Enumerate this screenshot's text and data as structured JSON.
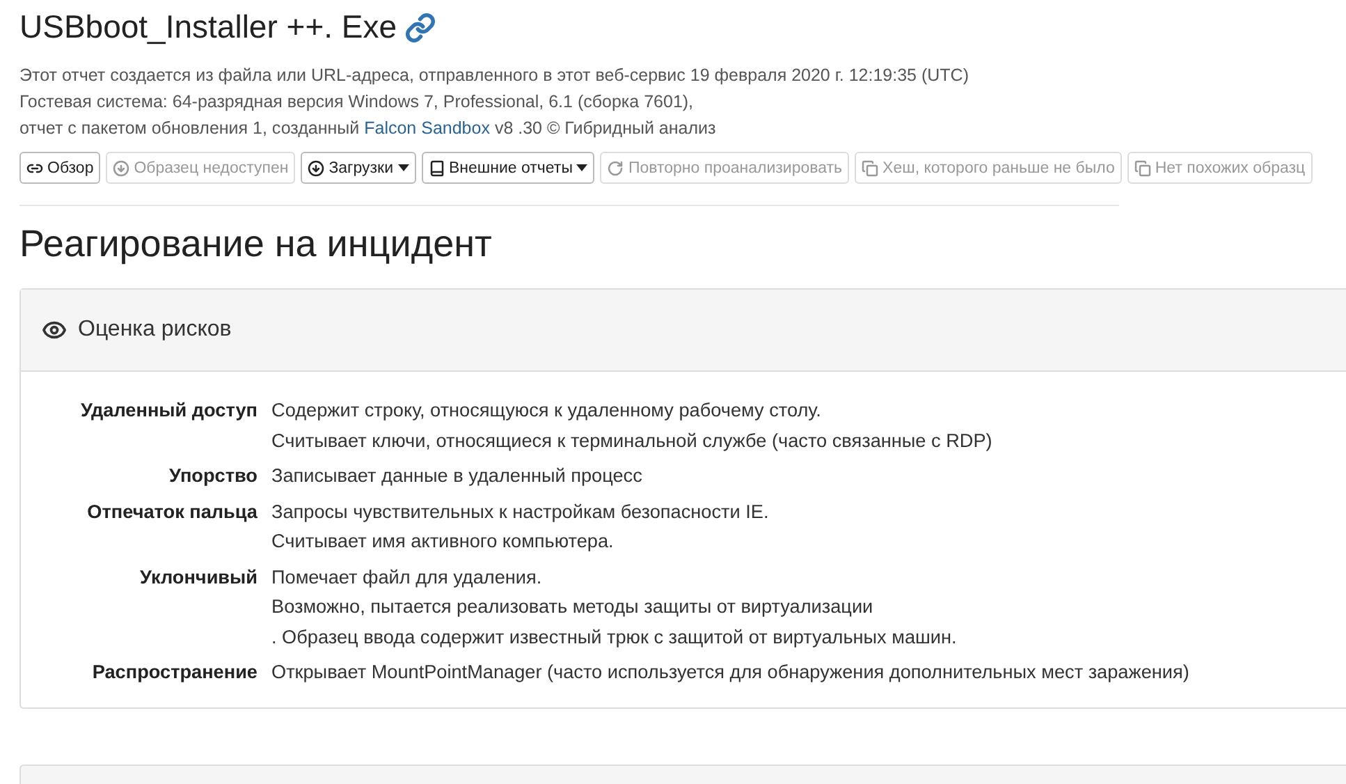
{
  "title": "USBboot_Installer ++. Exe",
  "info": {
    "line_1": "Этот отчет создается из файла или URL-адреса, отправленного в этот веб-сервис 19 февраля 2020 г. 12:19:35 (UTC)",
    "line_2": "Гостевая система: 64-разрядная версия Windows 7, Professional, 6.1 (сборка 7601),",
    "line_3_before": "отчет с пакетом обновления 1, созданный",
    "link": "Falcon Sandbox",
    "line_3_after": "v8 .30 © Гибридный анализ"
  },
  "toolbar": [
    {
      "label": "Обзор",
      "kind": "link",
      "disabled": false,
      "dropdown": false
    },
    {
      "label": "Образец недоступен",
      "kind": "download",
      "disabled": true,
      "dropdown": false
    },
    {
      "label": "Загрузки",
      "kind": "download",
      "disabled": false,
      "dropdown": true
    },
    {
      "label": "Внешние отчеты",
      "kind": "book",
      "disabled": false,
      "dropdown": true
    },
    {
      "label": "Повторно проанализировать",
      "kind": "refresh",
      "disabled": true,
      "dropdown": false
    },
    {
      "label": "Хеш, которого раньше не было",
      "kind": "copy",
      "disabled": true,
      "dropdown": false
    },
    {
      "label": "Нет похожих образц",
      "kind": "copy",
      "disabled": true,
      "dropdown": false
    }
  ],
  "section_title": "Реагирование на инцидент",
  "panel": {
    "title": "Оценка рисков",
    "rows": [
      {
        "category": "Удаленный доступ",
        "lines": [
          "Содержит строку, относящуюся к удаленному рабочему столу.",
          "Считывает ключи, относящиеся к терминальной службе (часто связанные с RDP)"
        ]
      },
      {
        "category": "Упорство",
        "lines": [
          "Записывает данные в удаленный процесс"
        ]
      },
      {
        "category": "Отпечаток пальца",
        "lines": [
          "Запросы чувствительных к настройкам безопасности IE.",
          "Считывает имя активного компьютера."
        ]
      },
      {
        "category": "Уклончивый",
        "lines": [
          "Помечает файл для удаления.",
          "Возможно, пытается реализовать методы защиты от виртуализации",
          ". Образец ввода содержит известный трюк с защитой от виртуальных машин."
        ]
      },
      {
        "category": "Распространение",
        "lines": [
          "Открывает MountPointManager (часто используется для обнаружения дополнительных мест заражения)"
        ]
      }
    ]
  }
}
